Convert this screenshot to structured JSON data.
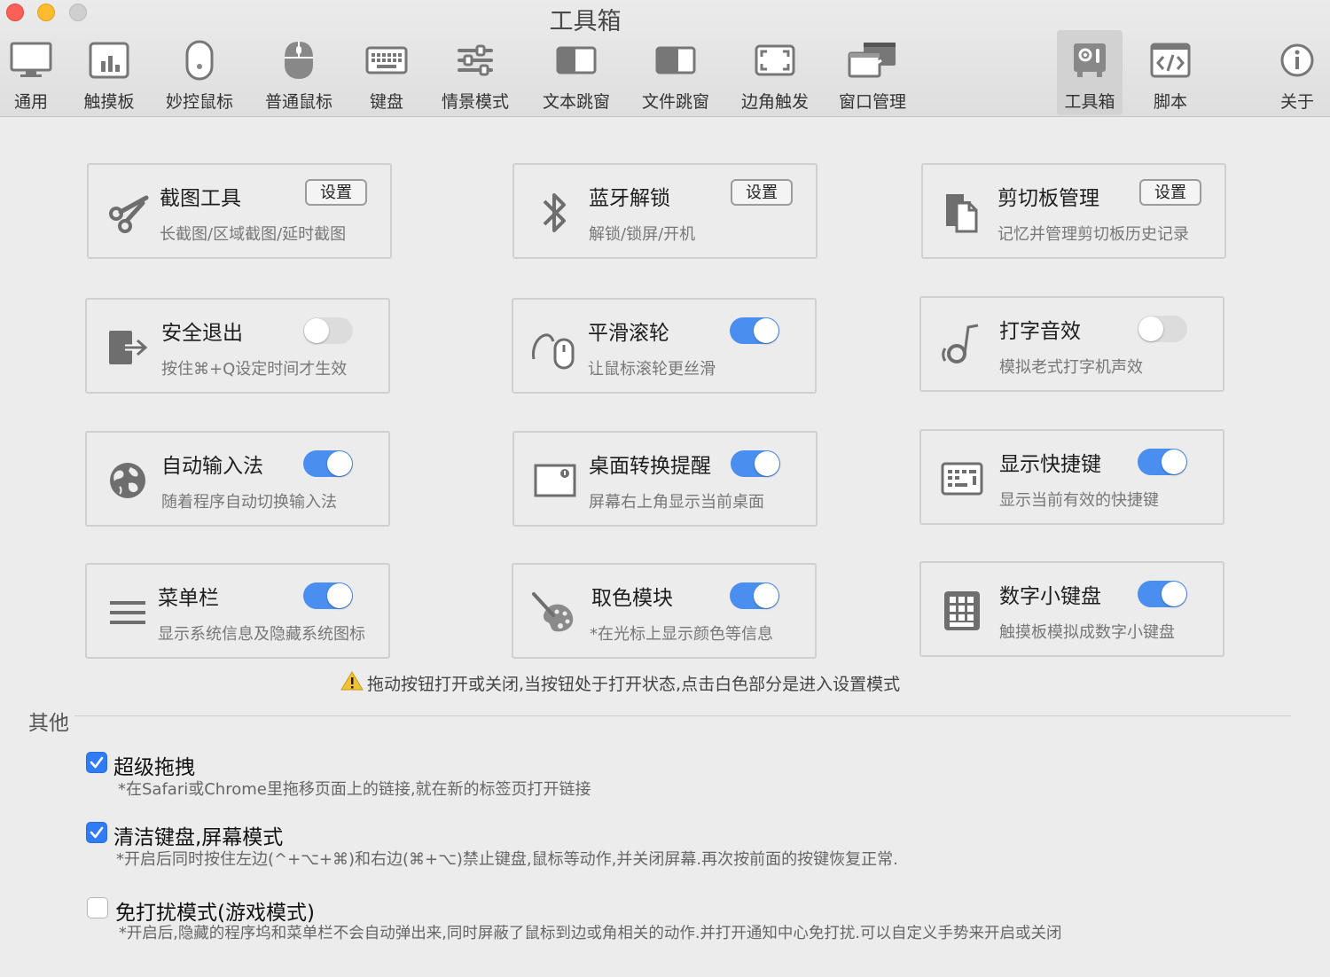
{
  "window": {
    "title": "工具箱"
  },
  "toolbar": [
    {
      "label": "通用",
      "icon": "monitor-icon"
    },
    {
      "label": "触摸板",
      "icon": "trackpad-icon"
    },
    {
      "label": "妙控鼠标",
      "icon": "magic-mouse-icon"
    },
    {
      "label": "普通鼠标",
      "icon": "mouse-icon"
    },
    {
      "label": "键盘",
      "icon": "keyboard-icon"
    },
    {
      "label": "情景模式",
      "icon": "sliders-icon"
    },
    {
      "label": "文本跳窗",
      "icon": "text-window-icon"
    },
    {
      "label": "文件跳窗",
      "icon": "file-window-icon"
    },
    {
      "label": "边角触发",
      "icon": "corner-icon"
    },
    {
      "label": "窗口管理",
      "icon": "window-manage-icon"
    },
    {
      "label": "工具箱",
      "icon": "toolbox-icon",
      "active": true
    },
    {
      "label": "脚本",
      "icon": "script-icon"
    },
    {
      "label": "关于",
      "icon": "info-icon"
    }
  ],
  "cards": [
    {
      "title": "截图工具",
      "subtitle": "长截图/区域截图/延时截图",
      "control": "button",
      "button_label": "设置",
      "icon": "scissors-icon"
    },
    {
      "title": "蓝牙解锁",
      "subtitle": "解锁/锁屏/开机",
      "control": "button",
      "button_label": "设置",
      "icon": "bluetooth-icon"
    },
    {
      "title": "剪切板管理",
      "subtitle": "记忆并管理剪切板历史记录",
      "control": "button",
      "button_label": "设置",
      "icon": "clipboard-icon"
    },
    {
      "title": "安全退出",
      "subtitle": "按住⌘+Q设定时间才生效",
      "control": "toggle",
      "on": false,
      "icon": "exit-icon"
    },
    {
      "title": "平滑滚轮",
      "subtitle": "让鼠标滚轮更丝滑",
      "control": "toggle",
      "on": true,
      "icon": "scroll-mouse-icon"
    },
    {
      "title": "打字音效",
      "subtitle": "模拟老式打字机声效",
      "control": "toggle",
      "on": false,
      "icon": "music-note-icon"
    },
    {
      "title": "自动输入法",
      "subtitle": "随着程序自动切换输入法",
      "control": "toggle",
      "on": true,
      "icon": "globe-icon"
    },
    {
      "title": "桌面转换提醒",
      "subtitle": "屏幕右上角显示当前桌面",
      "control": "toggle",
      "on": true,
      "icon": "desktop-badge-icon"
    },
    {
      "title": "显示快捷键",
      "subtitle": "显示当前有效的快捷键",
      "control": "toggle",
      "on": true,
      "icon": "shortcut-keyboard-icon"
    },
    {
      "title": "菜单栏",
      "subtitle": "显示系统信息及隐藏系统图标",
      "control": "toggle",
      "on": true,
      "icon": "menu-lines-icon"
    },
    {
      "title": "取色模块",
      "subtitle": "*在光标上显示颜色等信息",
      "control": "toggle",
      "on": true,
      "icon": "palette-icon"
    },
    {
      "title": "数字小键盘",
      "subtitle": "触摸板模拟成数字小键盘",
      "control": "toggle",
      "on": true,
      "icon": "numpad-icon"
    }
  ],
  "hint": {
    "text": "拖动按钮打开或关闭,当按钮处于打开状态,点击白色部分是进入设置模式",
    "icon": "warning-icon"
  },
  "others": {
    "label": "其他",
    "options": [
      {
        "title": "超级拖拽",
        "desc": "*在Safari或Chrome里拖移页面上的链接,就在新的标签页打开链接",
        "checked": true
      },
      {
        "title": "清洁键盘,屏幕模式",
        "desc": "*开启后同时按住左边(^+⌥+⌘)和右边(⌘+⌥)禁止键盘,鼠标等动作,并关闭屏幕.再次按前面的按键恢复正常.",
        "checked": true
      },
      {
        "title": "免打扰模式(游戏模式)",
        "desc": "*开启后,隐藏的程序坞和菜单栏不会自动弹出来,同时屏蔽了鼠标到边或角相关的动作.并打开通知中心免打扰.可以自定义手势来开启或关闭",
        "checked": false
      }
    ]
  },
  "colors": {
    "accent": "#4a8ff0",
    "checkbox": "#2f7cf6",
    "icon": "#6e6e6e"
  }
}
